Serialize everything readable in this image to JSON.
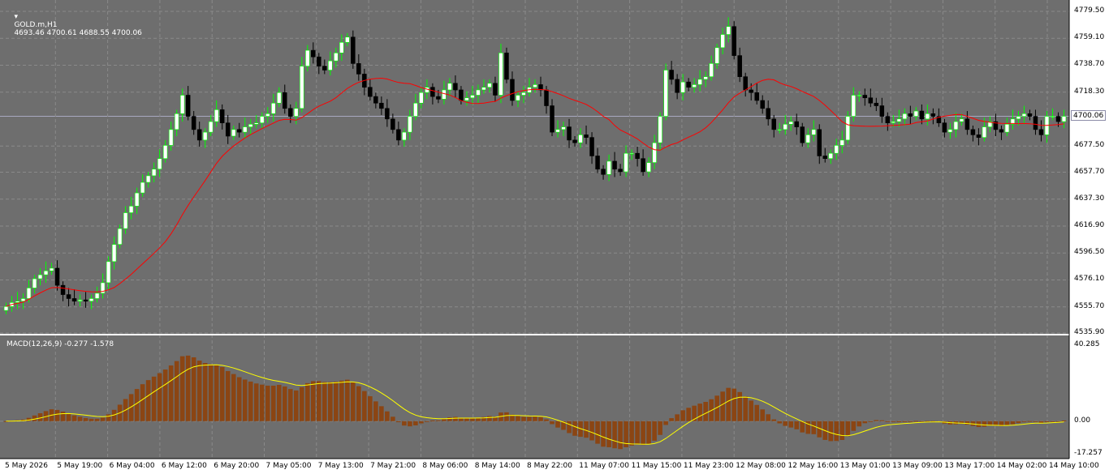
{
  "chart_header": {
    "symbol": "GOLD.m,H1",
    "ohlc": "4693.46 4700.61 4688.55 4700.06"
  },
  "colors": {
    "background": "#6e6e6e",
    "grid": "#8a8a8a",
    "bull_candle": "#ffffff",
    "bear_candle": "#000000",
    "wick": "#000000",
    "wick_bull": "#00ff00",
    "moving_average": "#ff0000",
    "macd_histogram": "#8b4513",
    "macd_signal": "#ffff00",
    "price_line": "#a8a8c0",
    "axis_panel": "#ffffff"
  },
  "price_axis": {
    "ticks": [
      "4779.50",
      "4759.10",
      "4738.70",
      "4718.30",
      "4700.06",
      "4677.50",
      "4657.70",
      "4637.30",
      "4616.90",
      "4596.50",
      "4576.10",
      "4555.70",
      "4535.90"
    ],
    "current_price": "4700.06"
  },
  "macd_panel": {
    "label": "MACD(12,26,9) -0.277 -1.578",
    "ticks": [
      "40.285",
      "0.00",
      "-17.257"
    ]
  },
  "time_axis": {
    "ticks": [
      "5 May 2026",
      "5 May 19:00",
      "6 May 04:00",
      "6 May 12:00",
      "6 May 20:00",
      "7 May 05:00",
      "7 May 13:00",
      "7 May 21:00",
      "8 May 06:00",
      "8 May 14:00",
      "8 May 22:00",
      "11 May 07:00",
      "11 May 15:00",
      "11 May 23:00",
      "12 May 08:00",
      "12 May 16:00",
      "13 May 01:00",
      "13 May 09:00",
      "13 May 17:00",
      "14 May 02:00",
      "14 May 10:00"
    ]
  },
  "chart_data": {
    "type": "candlestick",
    "symbol": "GOLD.m",
    "timeframe": "H1",
    "ylim": [
      4535.9,
      4785.0
    ],
    "closes": [
      4556,
      4559,
      4560,
      4562,
      4570,
      4577,
      4580,
      4583,
      4585,
      4572,
      4565,
      4562,
      4560,
      4561,
      4560,
      4562,
      4566,
      4574,
      4590,
      4603,
      4615,
      4627,
      4632,
      4642,
      4650,
      4655,
      4660,
      4668,
      4678,
      4690,
      4702,
      4716,
      4700,
      4690,
      4682,
      4688,
      4696,
      4705,
      4695,
      4685,
      4690,
      4688,
      4692,
      4694,
      4695,
      4700,
      4702,
      4710,
      4718,
      4706,
      4700,
      4706,
      4738,
      4750,
      4745,
      4738,
      4735,
      4742,
      4748,
      4756,
      4760,
      4740,
      4732,
      4722,
      4715,
      4710,
      4706,
      4698,
      4690,
      4682,
      4688,
      4700,
      4710,
      4718,
      4722,
      4715,
      4713,
      4720,
      4725,
      4720,
      4712,
      4714,
      4716,
      4720,
      4722,
      4725,
      4716,
      4748,
      4728,
      4712,
      4716,
      4718,
      4722,
      4724,
      4720,
      4708,
      4688,
      4690,
      4692,
      4682,
      4680,
      4686,
      4684,
      4670,
      4660,
      4656,
      4666,
      4660,
      4658,
      4672,
      4672,
      4668,
      4658,
      4665,
      4680,
      4700,
      4735,
      4728,
      4718,
      4726,
      4722,
      4724,
      4728,
      4730,
      4740,
      4752,
      4762,
      4768,
      4746,
      4730,
      4720,
      4718,
      4712,
      4706,
      4698,
      4690,
      4690,
      4694,
      4696,
      4692,
      4680,
      4686,
      4690,
      4670,
      4668,
      4672,
      4678,
      4682,
      4700,
      4716,
      4716,
      4714,
      4710,
      4708,
      4700,
      4695,
      4696,
      4698,
      4702,
      4700,
      4704,
      4698,
      4702,
      4700,
      4695,
      4688,
      4690,
      4696,
      4698,
      4690,
      4686,
      4684,
      4692,
      4696,
      4690,
      4688,
      4694,
      4698,
      4700,
      4702,
      4700,
      4690,
      4686,
      4700,
      4700,
      4696,
      4700
    ]
  }
}
